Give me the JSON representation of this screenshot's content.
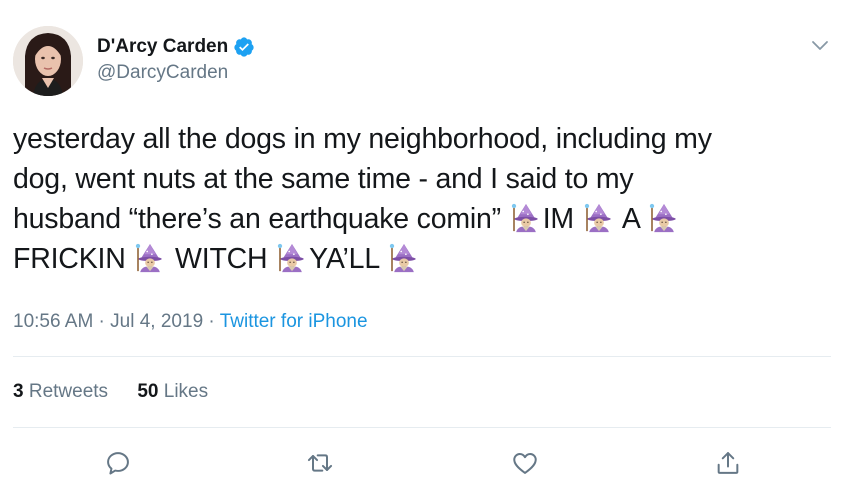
{
  "author": {
    "display_name": "D'Arcy Carden",
    "handle": "@DarcyCarden",
    "verified": true
  },
  "tweet": {
    "lines": [
      [
        {
          "t": "yesterday all the dogs in my neighborhood, including my"
        }
      ],
      [
        {
          "t": "dog, went nuts at the same time - and I said to my"
        }
      ],
      [
        {
          "t": "husband “there’s an earthquake comin” "
        },
        {
          "e": "mage"
        },
        {
          "t": "IM "
        },
        {
          "e": "mage"
        },
        {
          "t": " A "
        },
        {
          "e": "mage"
        }
      ],
      [
        {
          "t": "FRICKIN "
        },
        {
          "e": "mage"
        },
        {
          "t": " WITCH "
        },
        {
          "e": "mage"
        },
        {
          "t": "YA’LL "
        },
        {
          "e": "mage"
        }
      ]
    ]
  },
  "meta": {
    "time": "10:56 AM",
    "sep1": " · ",
    "date": "Jul 4, 2019",
    "sep2": " · ",
    "source": "Twitter for iPhone"
  },
  "stats": {
    "retweets_count": "3",
    "retweets_label": "Retweets",
    "likes_count": "50",
    "likes_label": "Likes"
  },
  "icons": {
    "verified": "verified-badge-icon",
    "caret": "chevron-down-icon",
    "reply": "reply-icon",
    "retweet": "retweet-icon",
    "like": "heart-icon",
    "share": "share-icon",
    "emoji": "mage-emoji-icon"
  },
  "colors": {
    "accent": "#1da1f2",
    "link": "#1b95e0",
    "secondary_text": "#657786",
    "primary_text": "#14171a",
    "divider": "#e6ecf0"
  }
}
